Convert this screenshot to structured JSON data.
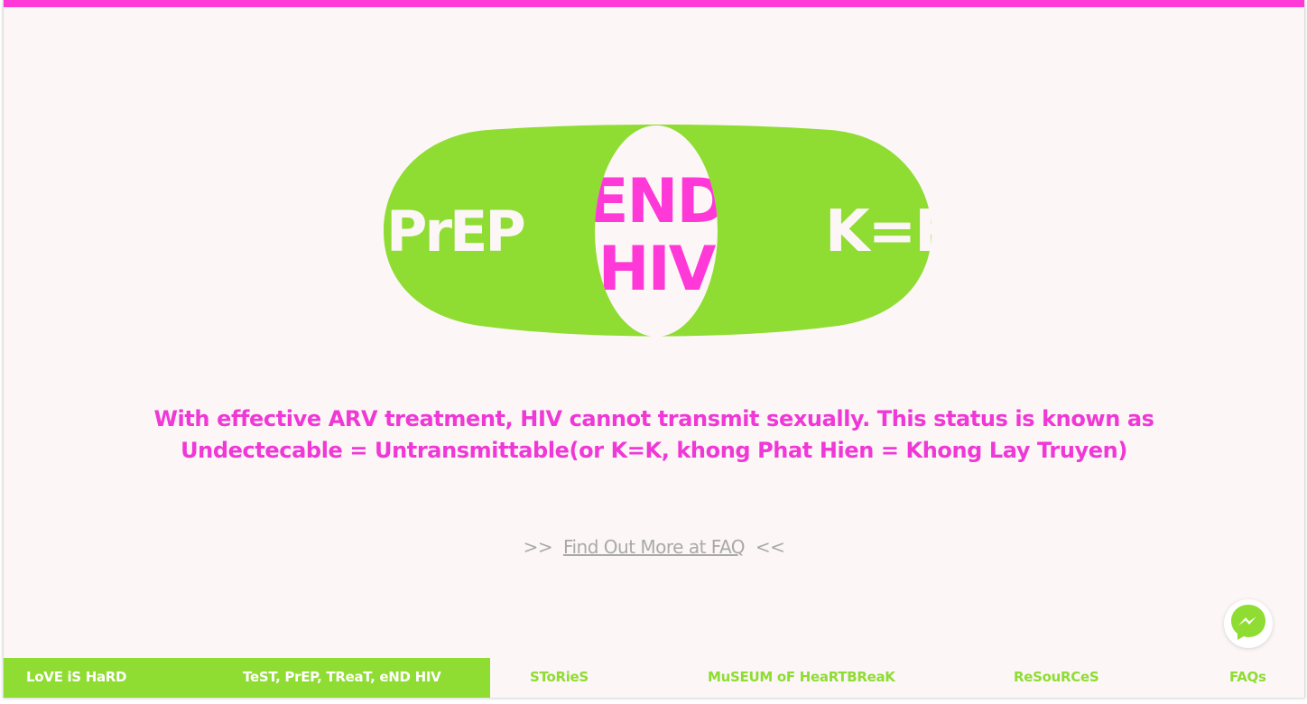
{
  "colors": {
    "accent_pink": "#ff38d8",
    "text_pink": "#ef38d6",
    "brand_green": "#8fdc32",
    "background": "#fcf6f6",
    "muted_gray": "#a9a9a9"
  },
  "hero": {
    "left_text": "PrEP",
    "center_line1": "END",
    "center_line2": "HIV",
    "right_text": "K=K"
  },
  "message": {
    "line1": "With effective ARV treatment, HIV cannot transmit sexually. This status is known as",
    "line2": "Undectecable = Untransmittable(or K=K, khong Phat Hien = Khong Lay Truyen)"
  },
  "faq": {
    "prefix": ">>",
    "link_label": "Find Out More at FAQ",
    "suffix": "<<"
  },
  "messenger": {
    "icon": "messenger-icon"
  },
  "nav": {
    "items": [
      {
        "label": "LoVE iS HaRD"
      },
      {
        "label": "TeST, PrEP, TReaT, eND HIV"
      },
      {
        "label": "SToRieS"
      },
      {
        "label": "MuSEUM oF HeaRTBReaK"
      },
      {
        "label": "ReSouRCeS"
      },
      {
        "label": "FAQs"
      }
    ]
  }
}
